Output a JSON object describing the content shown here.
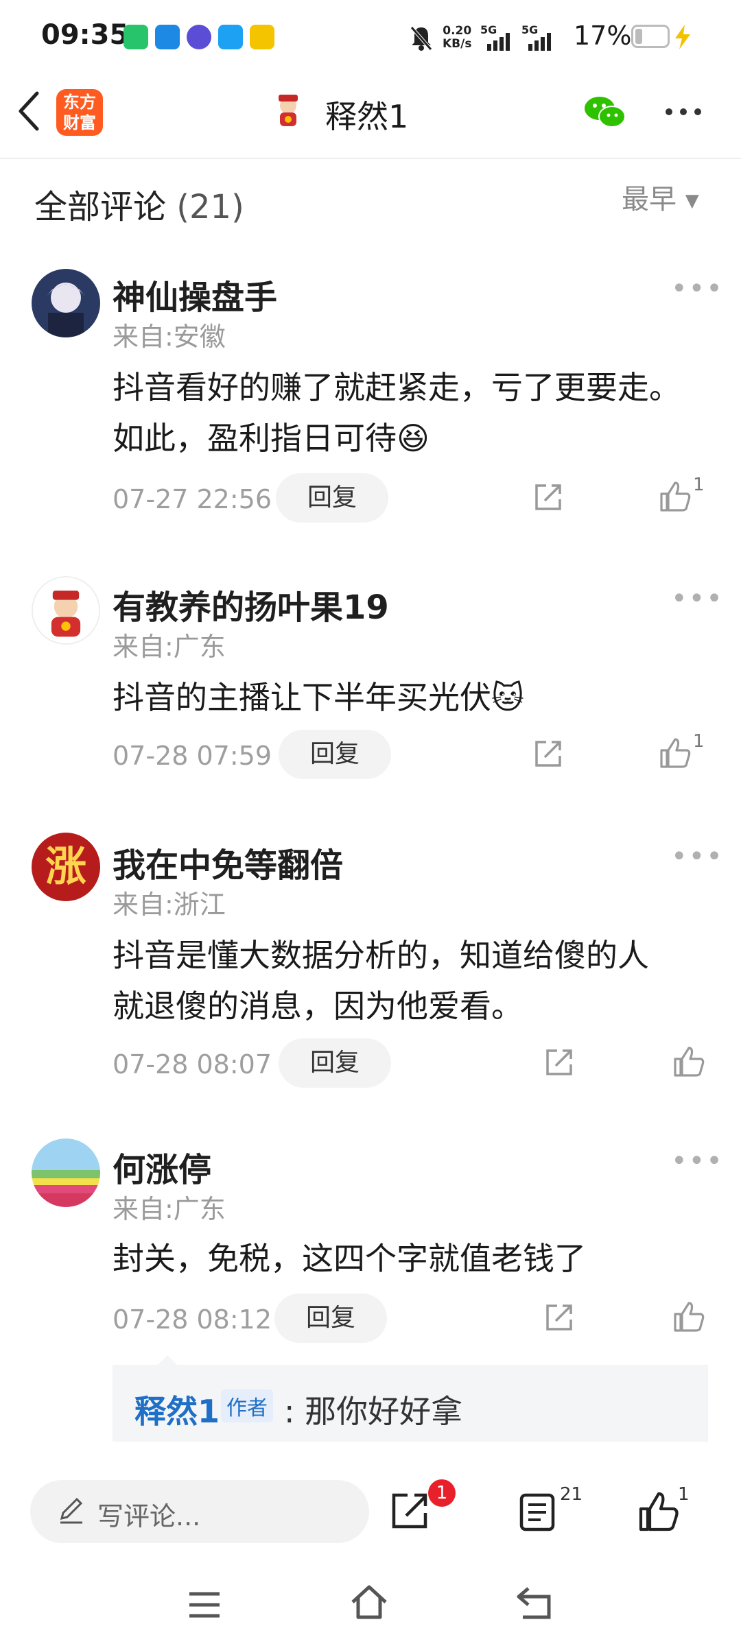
{
  "status_bar": {
    "time": "09:35",
    "net_speed_value": "0.20",
    "net_speed_unit": "KB/s",
    "signal1": "5G",
    "signal2": "5G",
    "battery": "17%",
    "app_icons": [
      "video-app-icon",
      "message-app-icon",
      "tieba-app-icon",
      "media-app-icon",
      "game-app-icon"
    ]
  },
  "top_bar": {
    "logo_line1": "东方",
    "logo_line2": "财富",
    "author_name": "释然1"
  },
  "comments_header": {
    "title": "全部评论",
    "count": "(21)",
    "sort": "最早"
  },
  "comments": [
    {
      "user": "神仙操盘手",
      "location": "来自:安徽",
      "lines": [
        "抖音看好的赚了就赶紧走，亏了更要走。",
        "如此，盈利指日可待😆"
      ],
      "date": "07-27 22:56",
      "reply_label": "回复",
      "likes": "1"
    },
    {
      "user": "有教养的扬叶果19",
      "location": "来自:广东",
      "lines": [
        "抖音的主播让下半年买光伏🐱"
      ],
      "date": "07-28 07:59",
      "reply_label": "回复",
      "likes": "1"
    },
    {
      "user": "我在中免等翻倍",
      "location": "来自:浙江",
      "avatar_text": "涨",
      "lines": [
        "抖音是懂大数据分析的，知道给傻的人",
        "就退傻的消息，因为他爱看。"
      ],
      "date": "07-28 08:07",
      "reply_label": "回复",
      "likes": ""
    },
    {
      "user": "何涨停",
      "location": "来自:广东",
      "lines": [
        "封关，免税，这四个字就值老钱了"
      ],
      "date": "07-28 08:12",
      "reply_label": "回复",
      "likes": ""
    }
  ],
  "author_reply": {
    "name": "释然1",
    "tag": "作者",
    "text": ": 那你好好拿"
  },
  "bottom_bar": {
    "write_placeholder": "写评论...",
    "share_badge": "1",
    "comment_count": "21",
    "like_count": "1"
  },
  "colors": {
    "brand": "#ff5a1f",
    "link_blue": "#1f6fc6",
    "badge_red": "#e8202a",
    "wechat_green": "#2dc100"
  }
}
